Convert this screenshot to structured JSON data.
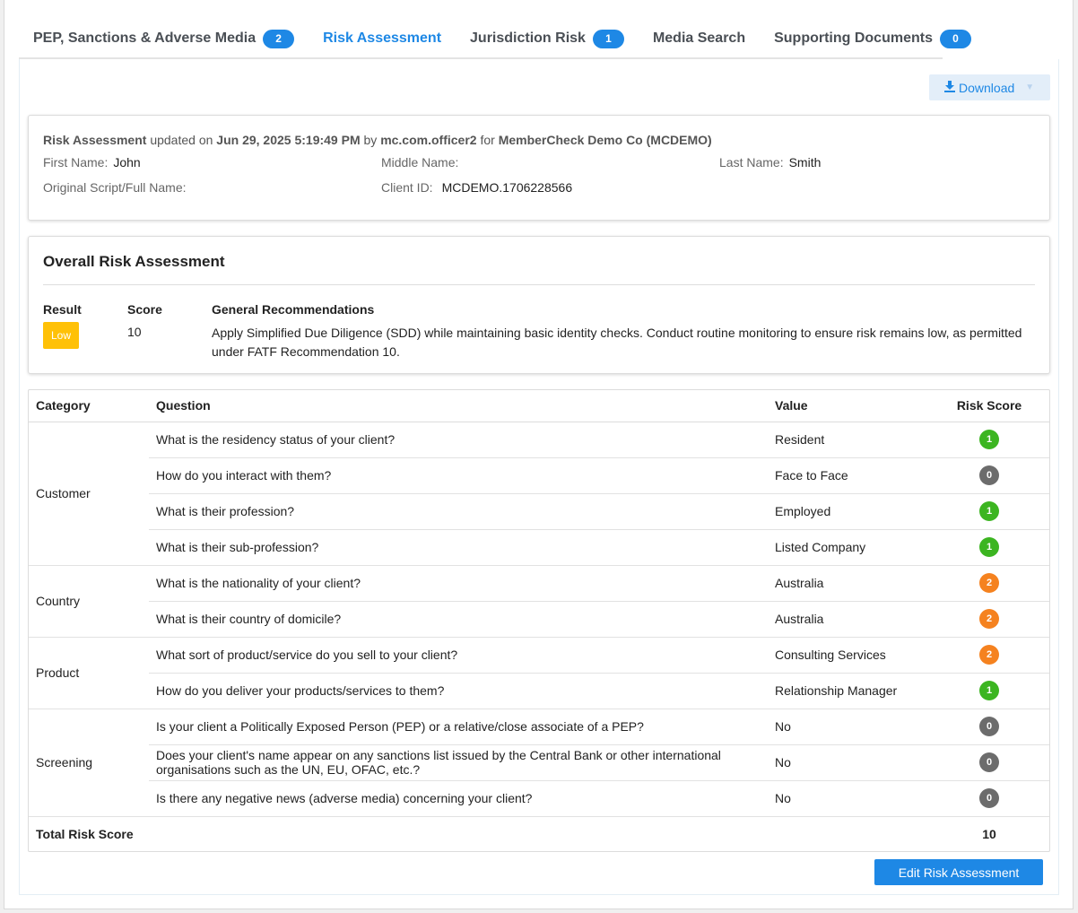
{
  "tabs": [
    {
      "label": "PEP, Sanctions & Adverse Media",
      "badge": "2"
    },
    {
      "label": "Risk Assessment",
      "badge": null
    },
    {
      "label": "Jurisdiction Risk",
      "badge": "1"
    },
    {
      "label": "Media Search",
      "badge": null
    },
    {
      "label": "Supporting Documents",
      "badge": "0"
    }
  ],
  "toolbar": {
    "download_label": "Download"
  },
  "info": {
    "title": "Risk Assessment",
    "updated_on_text": "updated on",
    "updated_date": "Jun 29, 2025 5:19:49 PM",
    "by_text": "by",
    "officer": "mc.com.officer2",
    "for_text": "for",
    "organisation": "MemberCheck Demo Co (MCDEMO)",
    "first_name_label": "First Name:",
    "first_name": "John",
    "middle_name_label": "Middle Name:",
    "middle_name": "",
    "last_name_label": "Last Name:",
    "last_name": "Smith",
    "original_script_label": "Original Script/Full Name:",
    "original_script": "",
    "client_id_label": "Client ID:",
    "client_id": "MCDEMO.1706228566"
  },
  "overall": {
    "title": "Overall Risk Assessment",
    "result_header": "Result",
    "score_header": "Score",
    "recommendations_header": "General Recommendations",
    "result": "Low",
    "score": "10",
    "recommendation": "Apply Simplified Due Diligence (SDD) while maintaining basic identity checks. Conduct routine monitoring to ensure risk remains low, as permitted under FATF Recommendation 10."
  },
  "table": {
    "headers": {
      "category": "Category",
      "question": "Question",
      "value": "Value",
      "risk_score": "Risk Score"
    },
    "categories": [
      {
        "name": "Customer",
        "rows": [
          {
            "question": "What is the residency status of your client?",
            "value": "Resident",
            "score": "1"
          },
          {
            "question": "How do you interact with them?",
            "value": "Face to Face",
            "score": "0"
          },
          {
            "question": "What is their profession?",
            "value": "Employed",
            "score": "1"
          },
          {
            "question": "What is their sub-profession?",
            "value": "Listed Company",
            "score": "1"
          }
        ]
      },
      {
        "name": "Country",
        "rows": [
          {
            "question": "What is the nationality of your client?",
            "value": "Australia",
            "score": "2"
          },
          {
            "question": "What is their country of domicile?",
            "value": "Australia",
            "score": "2"
          }
        ]
      },
      {
        "name": "Product",
        "rows": [
          {
            "question": "What sort of product/service do you sell to your client?",
            "value": "Consulting Services",
            "score": "2"
          },
          {
            "question": "How do you deliver your products/services to them?",
            "value": "Relationship Manager",
            "score": "1"
          }
        ]
      },
      {
        "name": "Screening",
        "rows": [
          {
            "question": "Is your client a Politically Exposed Person (PEP) or a relative/close associate of a PEP?",
            "value": "No",
            "score": "0"
          },
          {
            "question": "Does your client's name appear on any sanctions list issued by the Central Bank or other international organisations such as the UN, EU, OFAC, etc.?",
            "value": "No",
            "score": "0"
          },
          {
            "question": "Is there any negative news (adverse media) concerning your client?",
            "value": "No",
            "score": "0"
          }
        ]
      }
    ],
    "total_label": "Total Risk Score",
    "total_value": "10"
  },
  "score_colors": {
    "0": "#6c6c6c",
    "1": "#3cb521",
    "2": "#f5821f"
  },
  "accent_color": "#1e88e5",
  "low_color": "#ffc107",
  "actions": {
    "edit_label": "Edit Risk Assessment"
  }
}
